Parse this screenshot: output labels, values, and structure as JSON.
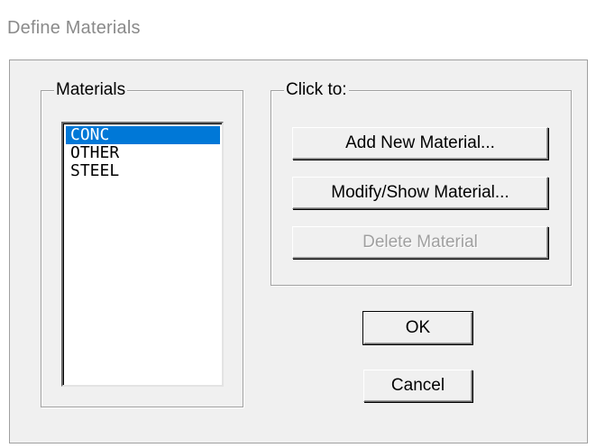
{
  "window": {
    "title": "Define Materials"
  },
  "materials_group": {
    "legend": "Materials",
    "items": [
      {
        "label": "CONC",
        "selected": true
      },
      {
        "label": "OTHER",
        "selected": false
      },
      {
        "label": "STEEL",
        "selected": false
      }
    ]
  },
  "actions_group": {
    "legend": "Click to:",
    "add_label": "Add New Material...",
    "modify_label": "Modify/Show Material...",
    "delete_label": "Delete Material",
    "delete_enabled": false
  },
  "dialog_buttons": {
    "ok_label": "OK",
    "cancel_label": "Cancel"
  },
  "colors": {
    "selection": "#0078d7",
    "dialog_face": "#f0f0f0",
    "disabled_text": "#a0a0a0"
  }
}
